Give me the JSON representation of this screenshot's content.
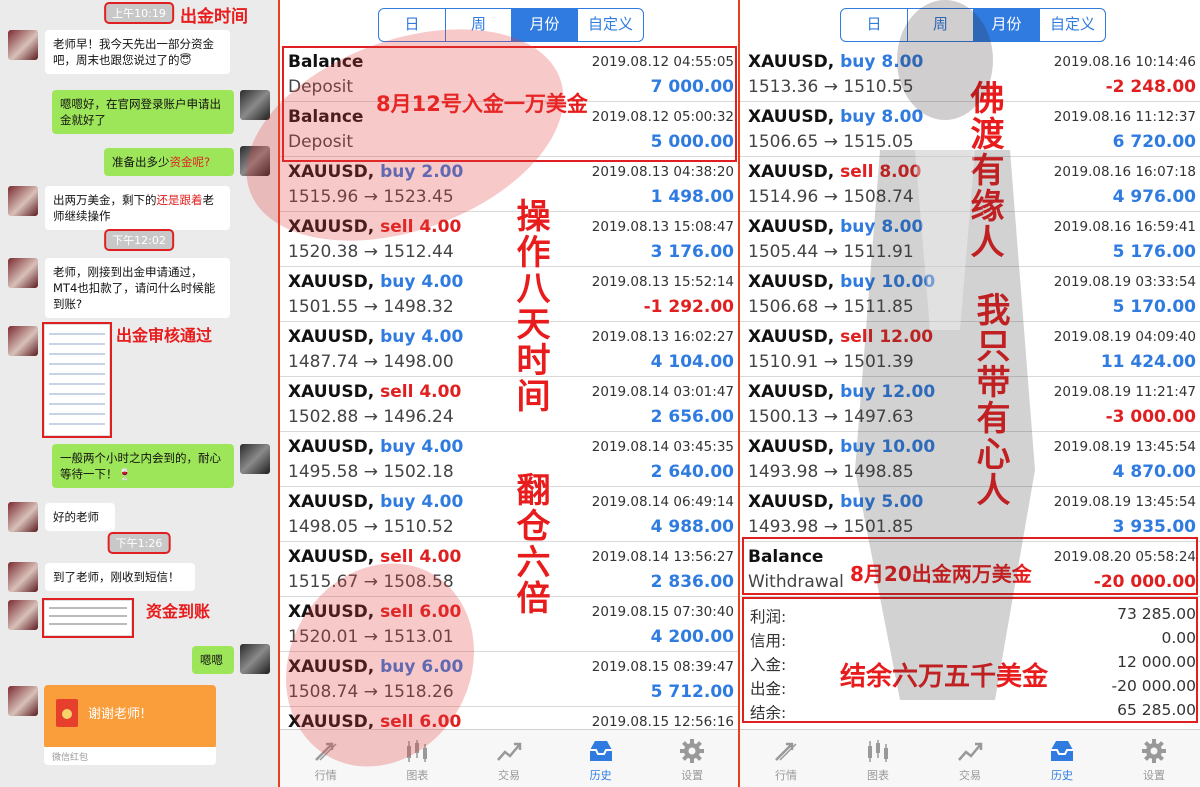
{
  "chat": {
    "times": [
      "上午10:19",
      "下午12:02",
      "下午1:26"
    ],
    "annotations": {
      "withdraw_time": "出金时间",
      "review_passed": "出金审核通过",
      "funds_arrived": "资金到账"
    },
    "messages": [
      {
        "side": "left",
        "text": "老师早！我今天先出一部分资金吧，周末也跟您说过了的😇"
      },
      {
        "side": "right",
        "text": "嗯嗯好，在官网登录账户申请出金就好了"
      },
      {
        "side": "right",
        "text_before": "准备出多少",
        "text_red": "资金呢?"
      },
      {
        "side": "left",
        "text_before": "出两万美金，剩下的",
        "text_red": "还是跟着",
        "text_after": "老师继续操作"
      },
      {
        "side": "left",
        "text": "老师，刚接到出金申请通过，MT4也扣款了，请问什么时候能到账?"
      },
      {
        "side": "right",
        "text": "一般两个小时之内会到的，耐心等待一下！🍷"
      },
      {
        "side": "left",
        "text": "好的老师"
      },
      {
        "side": "left",
        "text": "到了老师，刚收到短信！"
      },
      {
        "side": "right",
        "text": "嗯嗯"
      }
    ],
    "red_packet": {
      "text": "谢谢老师!",
      "footer": "微信红包"
    }
  },
  "history_left": {
    "tabs": [
      "日",
      "周",
      "月份",
      "自定义"
    ],
    "active_tab": "月份",
    "rows": [
      {
        "sym": "Balance",
        "side": "",
        "lots": "",
        "sub": "Deposit",
        "time": "2019.08.12 04:55:05",
        "pl": "7 000.00",
        "sign": "pos"
      },
      {
        "sym": "Balance",
        "side": "",
        "lots": "",
        "sub": "Deposit",
        "time": "2019.08.12 05:00:32",
        "pl": "5 000.00",
        "sign": "pos"
      },
      {
        "sym": "XAUUSD,",
        "side": "buy",
        "lots": "2.00",
        "sub": "1515.96 → 1523.45",
        "time": "2019.08.13 04:38:20",
        "pl": "1 498.00",
        "sign": "pos"
      },
      {
        "sym": "XAUUSD,",
        "side": "sell",
        "lots": "4.00",
        "sub": "1520.38 → 1512.44",
        "time": "2019.08.13 15:08:47",
        "pl": "3 176.00",
        "sign": "pos"
      },
      {
        "sym": "XAUUSD,",
        "side": "buy",
        "lots": "4.00",
        "sub": "1501.55 → 1498.32",
        "time": "2019.08.13 15:52:14",
        "pl": "-1 292.00",
        "sign": "neg"
      },
      {
        "sym": "XAUUSD,",
        "side": "buy",
        "lots": "4.00",
        "sub": "1487.74 → 1498.00",
        "time": "2019.08.13 16:02:27",
        "pl": "4 104.00",
        "sign": "pos"
      },
      {
        "sym": "XAUUSD,",
        "side": "sell",
        "lots": "4.00",
        "sub": "1502.88 → 1496.24",
        "time": "2019.08.14 03:01:47",
        "pl": "2 656.00",
        "sign": "pos"
      },
      {
        "sym": "XAUUSD,",
        "side": "buy",
        "lots": "4.00",
        "sub": "1495.58 → 1502.18",
        "time": "2019.08.14 03:45:35",
        "pl": "2 640.00",
        "sign": "pos"
      },
      {
        "sym": "XAUUSD,",
        "side": "buy",
        "lots": "4.00",
        "sub": "1498.05 → 1510.52",
        "time": "2019.08.14 06:49:14",
        "pl": "4 988.00",
        "sign": "pos"
      },
      {
        "sym": "XAUUSD,",
        "side": "sell",
        "lots": "4.00",
        "sub": "1515.67 → 1508.58",
        "time": "2019.08.14 13:56:27",
        "pl": "2 836.00",
        "sign": "pos"
      },
      {
        "sym": "XAUUSD,",
        "side": "sell",
        "lots": "6.00",
        "sub": "1520.01 → 1513.01",
        "time": "2019.08.15 07:30:40",
        "pl": "4 200.00",
        "sign": "pos"
      },
      {
        "sym": "XAUUSD,",
        "side": "buy",
        "lots": "6.00",
        "sub": "1508.74 → 1518.26",
        "time": "2019.08.15 08:39:47",
        "pl": "5 712.00",
        "sign": "pos"
      },
      {
        "sym": "XAUUSD,",
        "side": "sell",
        "lots": "6.00",
        "sub": "",
        "time": "2019.08.15 12:56:16",
        "pl": "",
        "sign": "pos"
      }
    ],
    "annotations": {
      "deposit": "8月12号入金一万美金",
      "days": "操作八天时间",
      "multiple": "翻仓六倍"
    }
  },
  "history_right": {
    "tabs": [
      "日",
      "周",
      "月份",
      "自定义"
    ],
    "active_tab": "月份",
    "rows": [
      {
        "sym": "XAUUSD,",
        "side": "buy",
        "lots": "8.00",
        "sub": "1513.36 → 1510.55",
        "time": "2019.08.16 10:14:46",
        "pl": "-2 248.00",
        "sign": "neg"
      },
      {
        "sym": "XAUUSD,",
        "side": "buy",
        "lots": "8.00",
        "sub": "1506.65 → 1515.05",
        "time": "2019.08.16 11:12:37",
        "pl": "6 720.00",
        "sign": "pos"
      },
      {
        "sym": "XAUUSD,",
        "side": "sell",
        "lots": "8.00",
        "sub": "1514.96 → 1508.74",
        "time": "2019.08.16 16:07:18",
        "pl": "4 976.00",
        "sign": "pos"
      },
      {
        "sym": "XAUUSD,",
        "side": "buy",
        "lots": "8.00",
        "sub": "1505.44 → 1511.91",
        "time": "2019.08.16 16:59:41",
        "pl": "5 176.00",
        "sign": "pos"
      },
      {
        "sym": "XAUUSD,",
        "side": "buy",
        "lots": "10.00",
        "sub": "1506.68 → 1511.85",
        "time": "2019.08.19 03:33:54",
        "pl": "5 170.00",
        "sign": "pos"
      },
      {
        "sym": "XAUUSD,",
        "side": "sell",
        "lots": "12.00",
        "sub": "1510.91 → 1501.39",
        "time": "2019.08.19 04:09:40",
        "pl": "11 424.00",
        "sign": "pos"
      },
      {
        "sym": "XAUUSD,",
        "side": "buy",
        "lots": "12.00",
        "sub": "1500.13 → 1497.63",
        "time": "2019.08.19 11:21:47",
        "pl": "-3 000.00",
        "sign": "neg"
      },
      {
        "sym": "XAUUSD,",
        "side": "buy",
        "lots": "10.00",
        "sub": "1493.98 → 1498.85",
        "time": "2019.08.19 13:45:54",
        "pl": "4 870.00",
        "sign": "pos"
      },
      {
        "sym": "XAUUSD,",
        "side": "buy",
        "lots": "5.00",
        "sub": "1493.98 → 1501.85",
        "time": "2019.08.19 13:45:54",
        "pl": "3 935.00",
        "sign": "pos"
      },
      {
        "sym": "Balance",
        "side": "",
        "lots": "",
        "sub": "Withdrawal",
        "time": "2019.08.20 05:58:24",
        "pl": "-20 000.00",
        "sign": "neg"
      }
    ],
    "summary": [
      {
        "k": "利润:",
        "v": "73 285.00"
      },
      {
        "k": "信用:",
        "v": "0.00"
      },
      {
        "k": "入金:",
        "v": "12 000.00"
      },
      {
        "k": "出金:",
        "v": "-20 000.00"
      },
      {
        "k": "结余:",
        "v": "65 285.00"
      }
    ],
    "annotations": {
      "withdraw": "8月20出金两万美金",
      "balance": "结余六万五千美金",
      "phrase1": "佛渡有缘人",
      "phrase2": "我只带有心人"
    }
  },
  "tabbar": [
    "行情",
    "图表",
    "交易",
    "历史",
    "设置"
  ],
  "active_bottom_tab": "历史",
  "icons": {
    "quotes": "arrows-icon",
    "chart": "candlestick-icon",
    "trade": "trend-icon",
    "history": "inbox-icon",
    "settings": "gear-icon"
  },
  "colors": {
    "accent": "#2f7be0",
    "loss": "#e02020",
    "annotation": "#e81c1c",
    "bubble_green": "#9ee659"
  }
}
